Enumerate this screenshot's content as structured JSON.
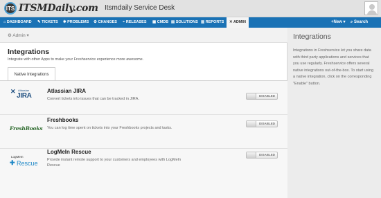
{
  "header": {
    "logo_text": "ITSMDaily.com",
    "logo_mark": "ITS",
    "app_title": "Itsmdaily Service Desk"
  },
  "nav": {
    "items": [
      {
        "icon": "⌂",
        "label": "DASHBOARD"
      },
      {
        "icon": "✎",
        "label": "TICKETS"
      },
      {
        "icon": "✱",
        "label": "PROBLEMS"
      },
      {
        "icon": "⚙",
        "label": "CHANGES"
      },
      {
        "icon": "⌁",
        "label": "RELEASES"
      },
      {
        "icon": "▦",
        "label": "CMDB"
      },
      {
        "icon": "▤",
        "label": "SOLUTIONS"
      },
      {
        "icon": "▥",
        "label": "REPORTS"
      },
      {
        "icon": "✕",
        "label": "ADMIN"
      }
    ],
    "new_label": "+New ▾",
    "search_label": "⌕ Search"
  },
  "breadcrumb": {
    "icon": "⚙",
    "label": "Admin ▾"
  },
  "page": {
    "title": "Integrations",
    "subtitle": "Integrate with other Apps to make your Freshservice experience more awesome."
  },
  "tabs": {
    "native": "Native Integrations"
  },
  "integrations": [
    {
      "name": "Atlassian JIRA",
      "description": "Convert tickets into issues that can be tracked in JIRA.",
      "logo_small": "Atlassian",
      "logo_big": "JIRA",
      "status": "DISABLED"
    },
    {
      "name": "Freshbooks",
      "description": "You can log time spent on tickets into your Freshbooks projects and tasks.",
      "logo_text": "FreshBooks",
      "status": "DISABLED"
    },
    {
      "name": "LogMeIn Rescue",
      "description": "Provide instant remote support to your customers and employees with LogMeIn Rescue",
      "logo_small": "LogMeIn",
      "logo_big": "Rescue",
      "status": "DISABLED"
    }
  ],
  "sidebar": {
    "title": "Integrations",
    "text": "Integrations in Freshservice let you share data with third party applications and services that you use regularly. Freshservice offers several native integrations out-of-the-box. To start using a native integration, click on the corresponding \"Enable\" button."
  },
  "colors": {
    "nav_bg": "#1a72b5",
    "jira_blue": "#205081",
    "freshbooks_green": "#6aa84f",
    "logmein_blue": "#1e88c7"
  }
}
